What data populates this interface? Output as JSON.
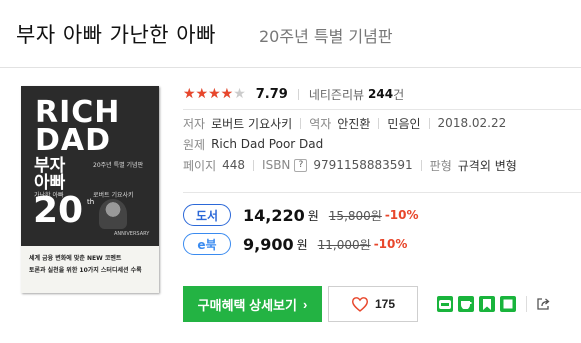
{
  "header": {
    "title": "부자 아빠 가난한 아빠",
    "subtitle": "20주년 특별 기념판"
  },
  "cover": {
    "title_en_1": "RICH",
    "title_en_2": "DAD",
    "title_ko": "부자 아빠",
    "edition": "20주년 특별 기념판",
    "subtitle_ko": "가난한 아빠",
    "author": "로버트 기요사키",
    "big_number": "20",
    "th": "th",
    "anniversary": "ANNIVERSARY",
    "band_line1": "세계 금융 변화에 맞춘 NEW 코멘트",
    "band_line2": "토론과 실천을 위한 10가지 스터디세션 수록"
  },
  "rating": {
    "score": "7.79",
    "score_fraction": 0.8,
    "review_label": "네티즌리뷰",
    "review_count": "244",
    "review_unit": "건"
  },
  "info": {
    "author_label": "저자",
    "author": "로버트 기요사키",
    "translator_label": "역자",
    "translator": "안진환",
    "publisher": "민음인",
    "date": "2018.02.22",
    "original_label": "원제",
    "original_title": "Rich Dad Poor Dad",
    "pages_label": "페이지",
    "pages": "448",
    "isbn_label": "ISBN",
    "isbn_help": "?",
    "isbn": "9791158883591",
    "format_label": "판형",
    "format": "규격외 변형"
  },
  "prices": {
    "book": {
      "label": "도서",
      "price": "14,220",
      "unit": "원",
      "original": "15,800원",
      "discount": "-10%"
    },
    "ebook": {
      "label": "e북",
      "price": "9,900",
      "unit": "원",
      "original": "11,000원",
      "discount": "-10%"
    }
  },
  "actions": {
    "buy_label": "구매혜택 상세보기",
    "like_count": "175"
  },
  "colors": {
    "accent_green": "#23b343",
    "star_red": "#e8472c",
    "badge_blue": "#2b68d8"
  }
}
